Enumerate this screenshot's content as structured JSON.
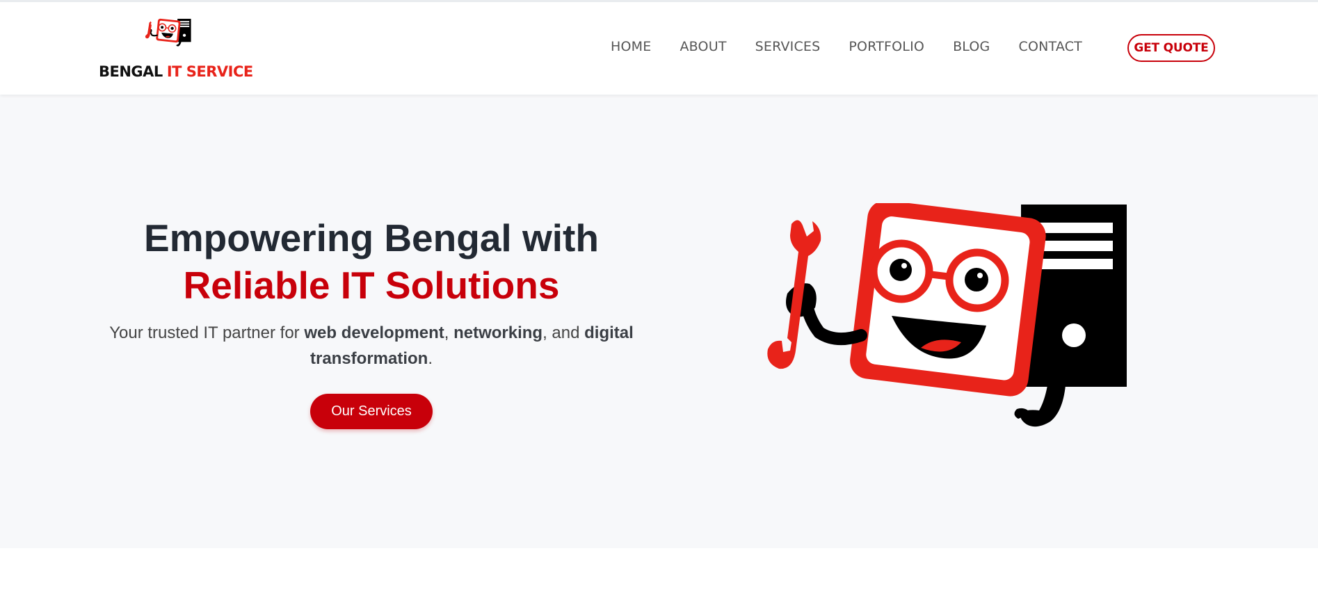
{
  "brand": {
    "name_part1": "BENGAL",
    "name_part2": "IT SERVICE",
    "logo_icon": "it-mascot-icon"
  },
  "nav": {
    "items": [
      {
        "label": "HOME"
      },
      {
        "label": "ABOUT"
      },
      {
        "label": "SERVICES"
      },
      {
        "label": "PORTFOLIO"
      },
      {
        "label": "BLOG"
      },
      {
        "label": "CONTACT"
      }
    ],
    "quote_label": "GET QUOTE"
  },
  "hero": {
    "title_line1": "Empowering Bengal with",
    "title_line2": "Reliable IT Solutions",
    "sub_prefix": "Your trusted IT partner for ",
    "sub_bold1": "web development",
    "sub_sep1": ", ",
    "sub_bold2": "networking",
    "sub_sep2": ", and ",
    "sub_bold3": "digital transformation",
    "sub_suffix": ".",
    "cta_label": "Our Services",
    "illustration_icon": "computer-mascot-with-wrench-icon"
  },
  "colors": {
    "accent_red": "#c8000a",
    "mascot_red": "#e8231a",
    "hero_bg": "#f7f8fa",
    "heading_dark": "#222933"
  }
}
